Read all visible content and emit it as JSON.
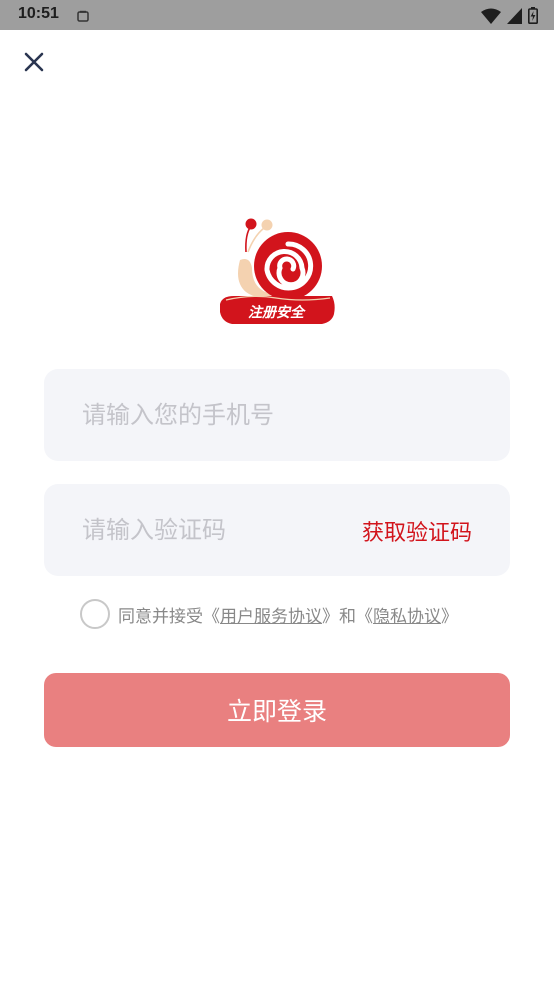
{
  "status_bar": {
    "time": "10:51",
    "icons": [
      "notification-icon",
      "wifi-icon",
      "signal-icon",
      "battery-icon"
    ]
  },
  "header": {
    "close_icon": "close-icon"
  },
  "logo": {
    "text": "注册安全",
    "colors": {
      "red": "#d2141c",
      "peach": "#f4d2b0"
    }
  },
  "form": {
    "phone_placeholder": "请输入您的手机号",
    "code_placeholder": "请输入验证码",
    "get_code_label": "获取验证码"
  },
  "agreement": {
    "prefix": "同意并接受《",
    "user_agreement": "用户服务协议",
    "middle": "》和《",
    "privacy_policy": "隐私协议",
    "suffix": "》"
  },
  "login_button": "立即登录",
  "colors": {
    "accent": "#d2141c",
    "button": "#e98080",
    "field_bg": "#f4f5f9"
  }
}
